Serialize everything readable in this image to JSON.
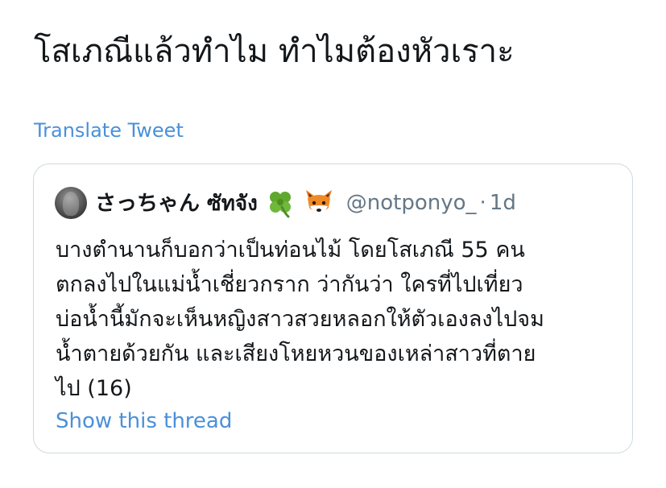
{
  "tweet": {
    "text": "โสเภณีแล้วทำไม ทำไมต้องหัวเราะ",
    "translate_label": "Translate Tweet"
  },
  "quoted_tweet": {
    "display_name": "さっちゃん ซัทจัง",
    "emojis": [
      "four-leaf-clover-icon",
      "fox-face-icon"
    ],
    "handle": "@notponyo_",
    "separator": "·",
    "time": "1d",
    "body_lines": [
      "บางตำนานก็บอกว่าเป็นท่อนไม้ โดยโสเภณี 55 คน",
      "ตกลงไปในแม่น้ำเชี่ยวกราก ว่ากันว่า ใครที่ไปเที่ยว",
      "บ่อน้ำนี้มักจะเห็นหญิงสาวสวยหลอกให้ตัวเองลงไปจม",
      "น้ำตายด้วยกัน และเสียงโหยหวนของเหล่าสาวที่ตาย",
      "ไป (16)"
    ],
    "show_thread_label": "Show this thread"
  },
  "colors": {
    "link": "#4a90d9",
    "text": "#14171a",
    "muted": "#657786",
    "border": "#cfd9de"
  }
}
